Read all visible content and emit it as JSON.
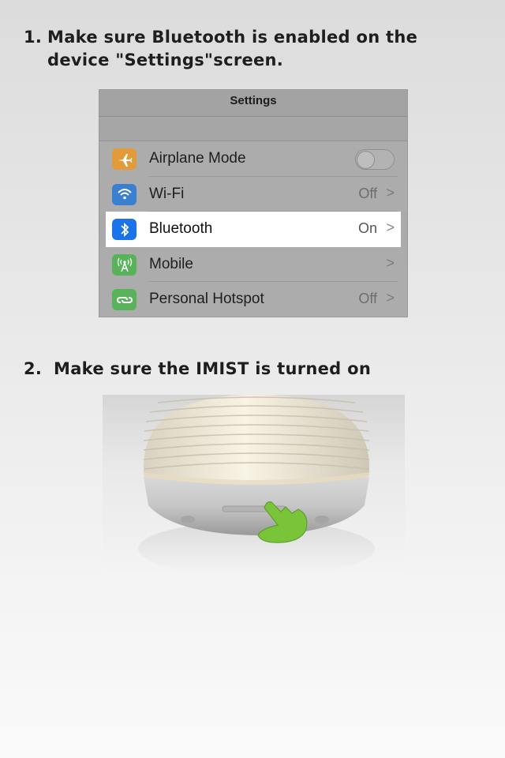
{
  "step1": {
    "number": "1.",
    "line1": "Make sure Bluetooth is enabled on the",
    "line2": "device \"Settings\"screen."
  },
  "settings": {
    "title": "Settings",
    "rows": [
      {
        "label": "Airplane Mode",
        "icon": "airplane-icon",
        "color": "#f0a640",
        "control": "toggle",
        "value": ""
      },
      {
        "label": "Wi-Fi",
        "icon": "wifi-icon",
        "color": "#3a7fd8",
        "value": "Off"
      },
      {
        "label": "Bluetooth",
        "icon": "bluetooth-icon",
        "color": "#1a73e8",
        "value": "On"
      },
      {
        "label": "Mobile",
        "icon": "mobile-signal-icon",
        "color": "#58b85a",
        "value": ""
      },
      {
        "label": "Personal Hotspot",
        "icon": "hotspot-icon",
        "color": "#58b85a",
        "value": "Off"
      }
    ]
  },
  "step2": {
    "number": "2.",
    "text": "Make sure the IMIST is turned on"
  },
  "colors": {
    "hand": "#7ac43a",
    "highlight": "#ffffff"
  }
}
